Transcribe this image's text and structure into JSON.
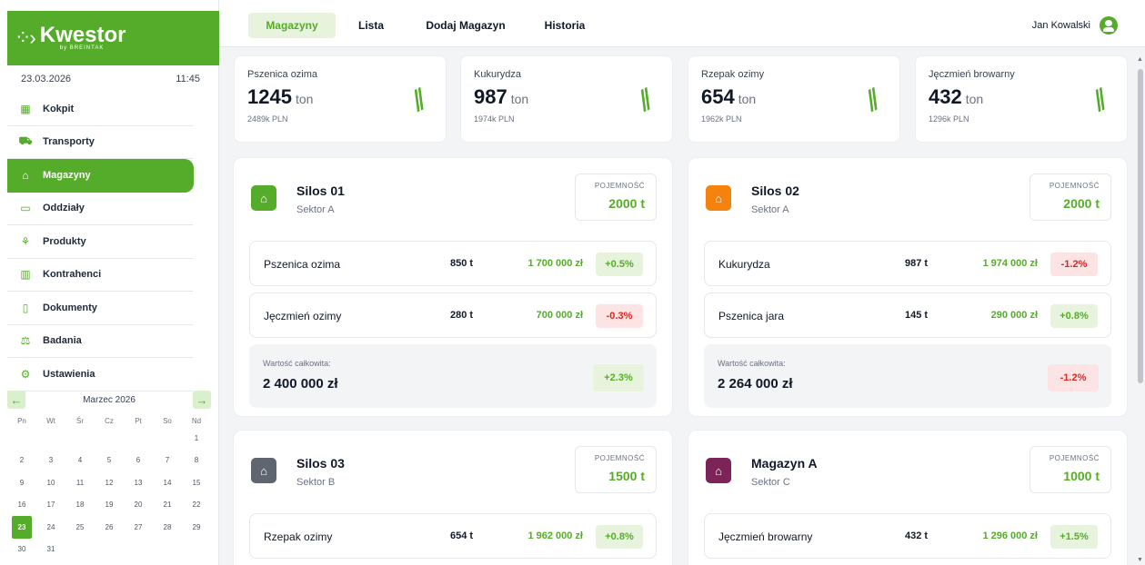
{
  "brand": {
    "name": "Kwestor",
    "sub": "by BREINTAK",
    "color": "#55ac2a"
  },
  "datetime": {
    "date": "23.03.2026",
    "time": "11:45"
  },
  "nav": [
    {
      "label": "Kokpit",
      "icon": "dashboard-icon",
      "glyph": "▦"
    },
    {
      "label": "Transporty",
      "icon": "truck-icon",
      "glyph": "⛟"
    },
    {
      "label": "Magazyny",
      "icon": "warehouse-icon",
      "glyph": "⌂",
      "active": true
    },
    {
      "label": "Oddziały",
      "icon": "folder-icon",
      "glyph": "▭"
    },
    {
      "label": "Produkty",
      "icon": "sprout-icon",
      "glyph": "⚘"
    },
    {
      "label": "Kontrahenci",
      "icon": "building-icon",
      "glyph": "▥"
    },
    {
      "label": "Dokumenty",
      "icon": "document-icon",
      "glyph": "▯"
    },
    {
      "label": "Badania",
      "icon": "scale-icon",
      "glyph": "⚖"
    },
    {
      "label": "Ustawienia",
      "icon": "gear-icon",
      "glyph": "⚙"
    }
  ],
  "calendar": {
    "title": "Marzec 2026",
    "prev": "←",
    "next": "→",
    "dow": [
      "Pn",
      "Wt",
      "Śr",
      "Cz",
      "Pt",
      "So",
      "Nd"
    ],
    "today": 23
  },
  "tabs": [
    {
      "label": "Magazyny",
      "active": true
    },
    {
      "label": "Lista"
    },
    {
      "label": "Dodaj Magazyn"
    },
    {
      "label": "Historia"
    }
  ],
  "user": {
    "name": "Jan Kowalski"
  },
  "summary": [
    {
      "name": "Pszenica ozima",
      "value": "1245",
      "unit": "ton",
      "pln": "2489k PLN"
    },
    {
      "name": "Kukurydza",
      "value": "987",
      "unit": "ton",
      "pln": "1974k PLN"
    },
    {
      "name": "Rzepak ozimy",
      "value": "654",
      "unit": "ton",
      "pln": "1962k PLN"
    },
    {
      "name": "Jęczmień browarny",
      "value": "432",
      "unit": "ton",
      "pln": "1296k PLN"
    }
  ],
  "silos": [
    {
      "name": "Silos 01",
      "sector": "Sektor A",
      "color": "#55ac2a",
      "capacity_label": "POJEMNOŚĆ",
      "capacity": "2000 t",
      "rows": [
        {
          "product": "Pszenica ozima",
          "qty": "850 t",
          "pln": "1 700 000 zł",
          "change": "+0.5%",
          "trend": "up"
        },
        {
          "product": "Jęczmień ozimy",
          "qty": "280 t",
          "pln": "700 000 zł",
          "change": "-0.3%",
          "trend": "down"
        }
      ],
      "total_label": "Wartość całkowita:",
      "total": "2 400 000 zł",
      "total_change": "+2.3%",
      "total_trend": "up"
    },
    {
      "name": "Silos 02",
      "sector": "Sektor A",
      "color": "#f5820d",
      "capacity_label": "POJEMNOŚĆ",
      "capacity": "2000 t",
      "rows": [
        {
          "product": "Kukurydza",
          "qty": "987 t",
          "pln": "1 974 000 zł",
          "change": "-1.2%",
          "trend": "down"
        },
        {
          "product": "Pszenica jara",
          "qty": "145 t",
          "pln": "290 000 zł",
          "change": "+0.8%",
          "trend": "up"
        }
      ],
      "total_label": "Wartość całkowita:",
      "total": "2 264 000 zł",
      "total_change": "-1.2%",
      "total_trend": "down"
    },
    {
      "name": "Silos 03",
      "sector": "Sektor B",
      "color": "#5f6670",
      "capacity_label": "POJEMNOŚĆ",
      "capacity": "1500 t",
      "rows": [
        {
          "product": "Rzepak ozimy",
          "qty": "654 t",
          "pln": "1 962 000 zł",
          "change": "+0.8%",
          "trend": "up"
        }
      ]
    },
    {
      "name": "Magazyn A",
      "sector": "Sektor C",
      "color": "#7c2457",
      "capacity_label": "POJEMNOŚĆ",
      "capacity": "1000 t",
      "rows": [
        {
          "product": "Jęczmień browarny",
          "qty": "432 t",
          "pln": "1 296 000 zł",
          "change": "+1.5%",
          "trend": "up"
        }
      ]
    }
  ]
}
